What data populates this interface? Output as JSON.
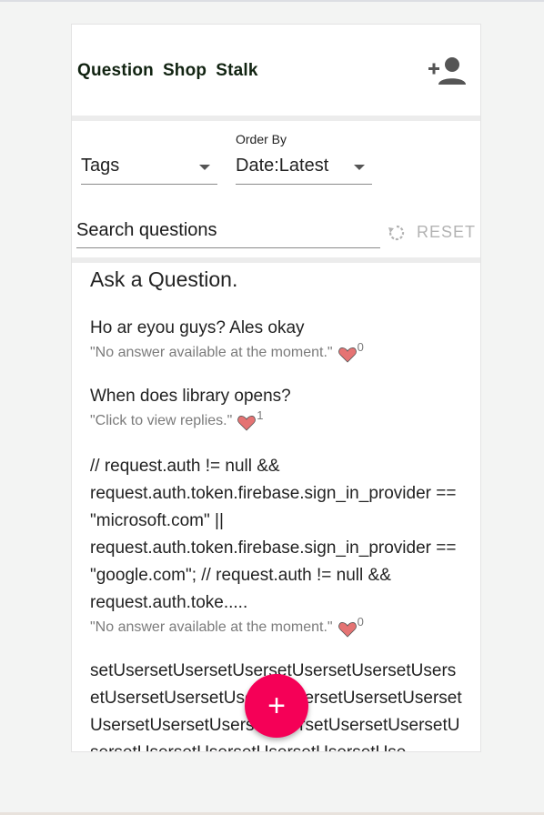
{
  "nav": {
    "links": [
      "Question",
      "Shop",
      "Stalk"
    ]
  },
  "filters": {
    "tags": {
      "value": "Tags"
    },
    "order": {
      "caption": "Order By",
      "value": "Date:Latest"
    }
  },
  "search": {
    "text": "Search questions"
  },
  "reset_label": "RESET",
  "list": {
    "title": "Ask a Question.",
    "questions": [
      {
        "title": "Ho ar eyou guys? Ales okay",
        "status": "\"No answer available at the moment.\"",
        "likes": "0"
      },
      {
        "title": "When does library opens?",
        "status": "\"Click to view replies.\"",
        "likes": "1"
      },
      {
        "title": "// request.auth != null && request.auth.token.firebase.sign_in_provider == \"microsoft.com\" || request.auth.token.firebase.sign_in_provider == \"google.com\"; // request.auth != null && request.auth.toke.....",
        "status": "\"No answer available at the moment.\"",
        "likes": "0"
      },
      {
        "title": "setUsersetUsersetUsersetUsersetUsersetUsersetUsersetUsersetUsersetUsersetUsersetUsersetUsersetUsersetUsersetUsersetUsersetUsersetUsersetUsersetUsersetUsersetUsersetUse",
        "status": "",
        "likes": ""
      }
    ]
  },
  "fab_label": "+",
  "icons": {
    "add_user": "person-add-icon",
    "reset": "refresh-icon",
    "heart": "heart-icon",
    "dropdown": "arrow-drop-down-icon"
  },
  "colors": {
    "accent": "#f50057",
    "nav_text": "#112311",
    "heart": "#e57373"
  }
}
